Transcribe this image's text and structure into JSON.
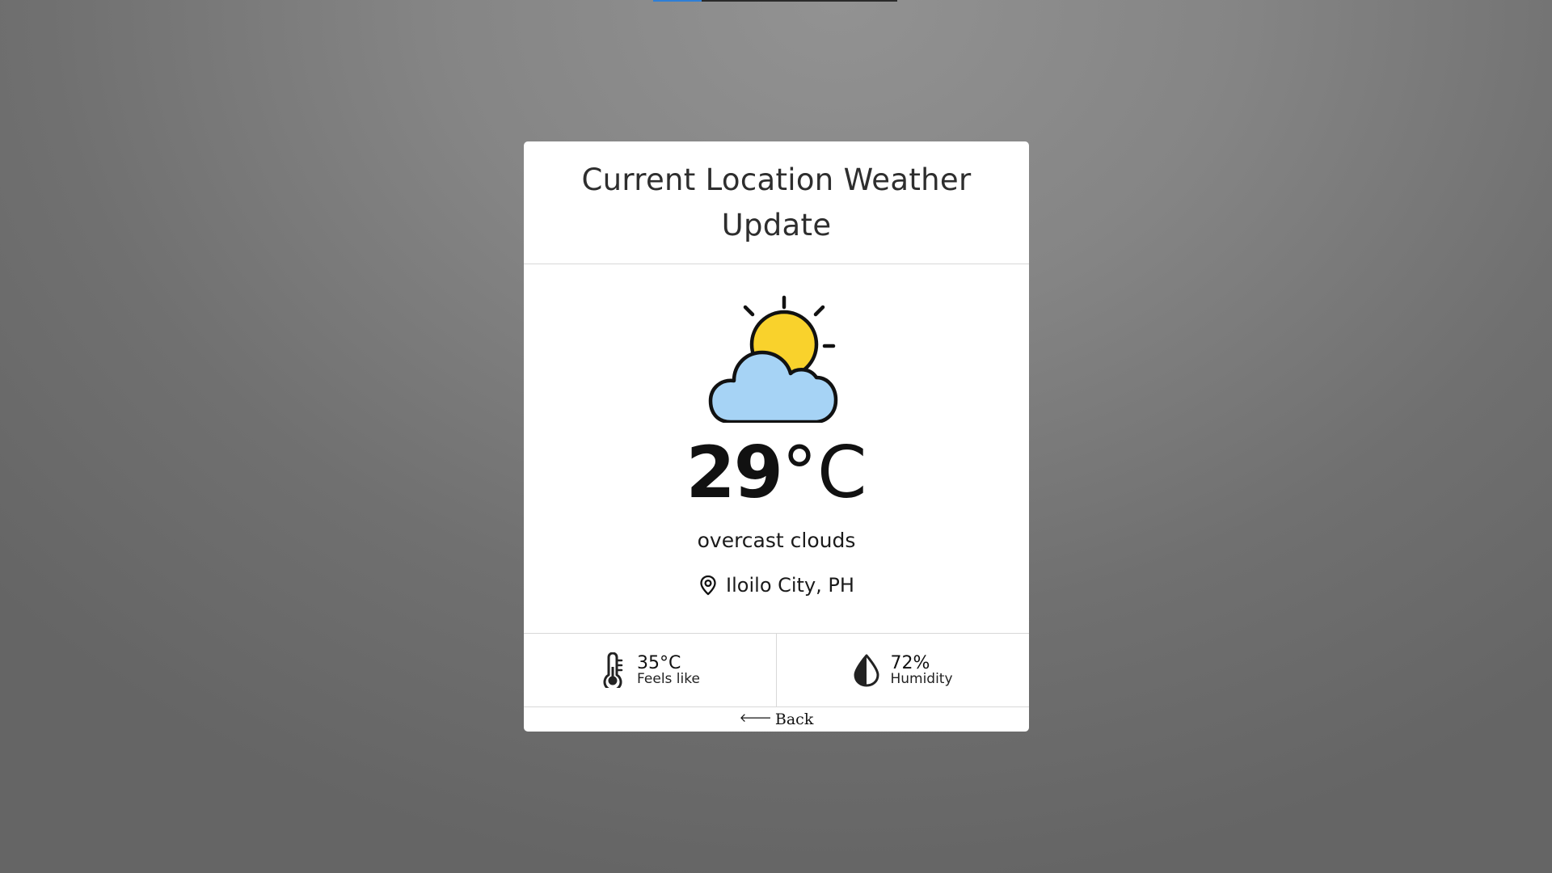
{
  "top_progress": {
    "fraction": 0.2,
    "fill_color": "#2f7fd6",
    "track_color": "#2a2a2a"
  },
  "card": {
    "title": "Current Location Weather Update",
    "weather_icon": "partly-cloudy-icon",
    "temperature": {
      "value": "29",
      "unit": "°C"
    },
    "description": "overcast clouds",
    "location": {
      "icon": "location-pin-icon",
      "text": "Iloilo City, PH"
    },
    "stats": [
      {
        "icon": "thermometer-icon",
        "value": "35°C",
        "label": "Feels like"
      },
      {
        "icon": "humidity-drop-icon",
        "value": "72%",
        "label": "Humidity"
      }
    ],
    "back": {
      "icon": "arrow-left-icon",
      "label": "Back"
    }
  },
  "colors": {
    "sun": "#f9d22c",
    "cloud": "#a6d3f5",
    "outline": "#111111"
  }
}
